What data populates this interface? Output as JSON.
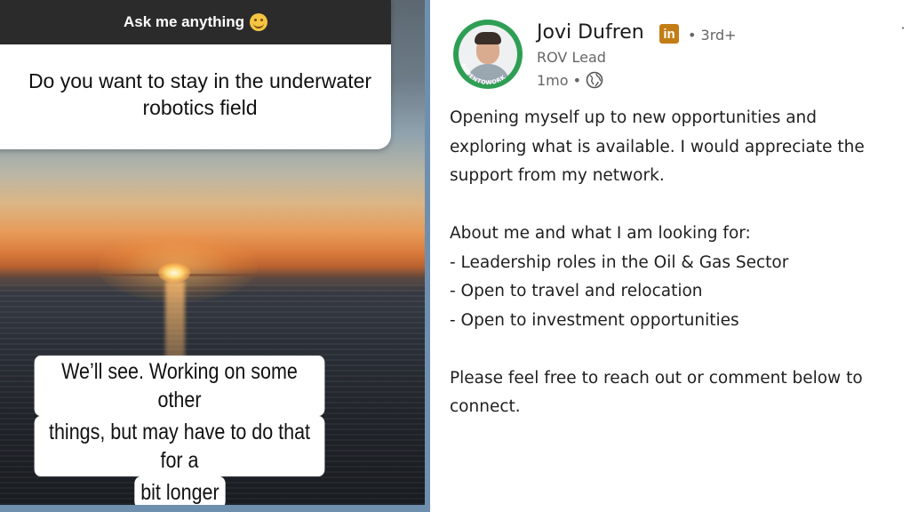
{
  "story": {
    "question_header": "Ask me anything",
    "header_emoji": "grinning-face-emoji",
    "question": "Do you want to stay in the underwater robotics field",
    "reply_lines": [
      "We’ll see. Working on some other",
      "things, but may have to do that for a",
      "bit longer"
    ]
  },
  "post": {
    "author": {
      "name": "Jovi Dufren",
      "premium_badge": "in",
      "degree": "• 3rd+",
      "headline": "ROV Lead",
      "time": "1mo",
      "visibility_icon": "globe-icon",
      "avatar_frame_text": "#OPENTOWORK"
    },
    "body": {
      "intro": [
        "Opening myself up to new opportunities and",
        "exploring what is available. I would appreciate the",
        "support from my network."
      ],
      "looking_for_heading": "About me and what I am looking for:",
      "bullets": [
        "- Leadership roles in the Oil & Gas Sector",
        "- Open to travel and relocation",
        "- Open to investment opportunities"
      ],
      "closing": [
        "Please feel free to reach out or comment below to",
        "connect."
      ]
    },
    "more_menu_icon": "overflow-menu-icon"
  },
  "colors": {
    "open_to_work_green": "#2f9e55",
    "premium_gold": "#c37d16",
    "story_frame_blue": "#6f8fae"
  }
}
